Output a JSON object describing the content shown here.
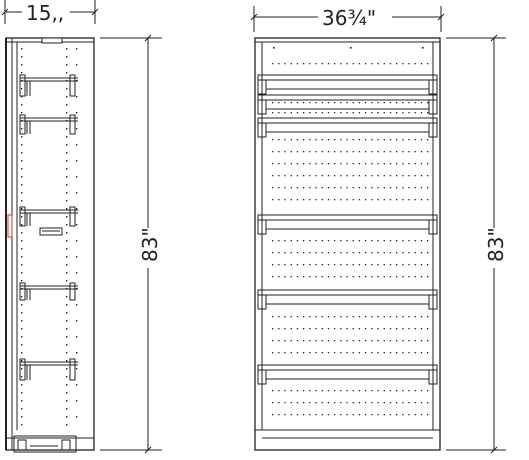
{
  "side_view": {
    "width_label": "15,,",
    "height_label": "83\""
  },
  "front_view": {
    "width_label": "36¾\"",
    "height_label": "83\""
  },
  "colors": {
    "line": "#222222",
    "accent": "#c0392b"
  }
}
